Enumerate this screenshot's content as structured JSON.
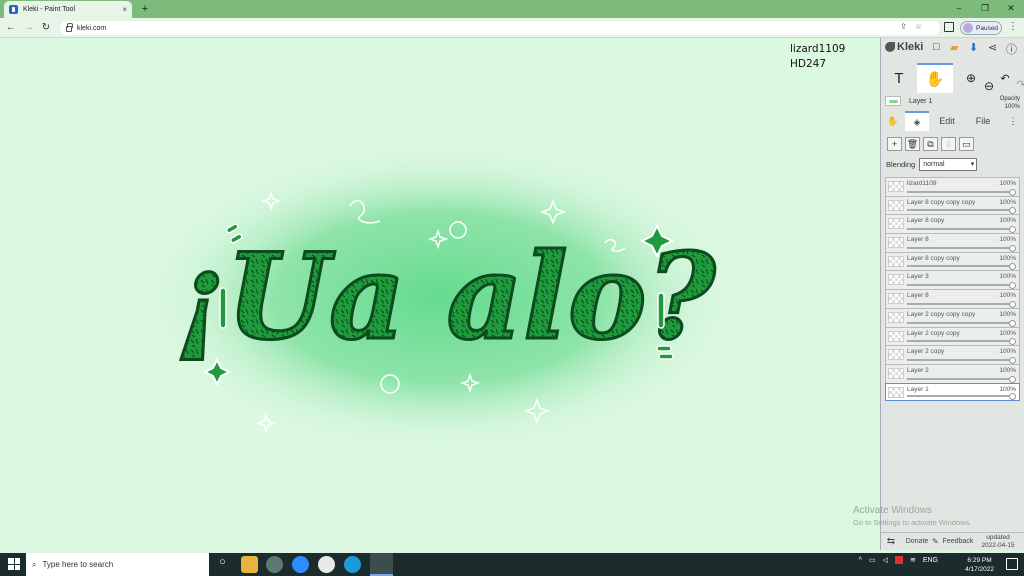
{
  "browser": {
    "tab_title": "Kleki - Paint Tool",
    "new_tab": "+",
    "close_tab": "×",
    "url": "kleki.com",
    "profile_status": "Paused",
    "window_controls": {
      "minimize": "–",
      "restore": "❐",
      "close": "✕"
    }
  },
  "canvas": {
    "author_note_line1": "lizard1109",
    "author_note_line2": "HD247",
    "artwork_text": "¡Ua alo?"
  },
  "app": {
    "logo": "Kleki",
    "active_tool_icon": "hand-icon",
    "current_layer": "Layer 1",
    "opacity_label": "Opacity",
    "opacity_value": "100%",
    "tabs": {
      "edit": "Edit",
      "file": "File"
    },
    "blending_label": "Blending",
    "blending_value": "normal",
    "layers": [
      {
        "name": "lizard1109",
        "opacity": "100%"
      },
      {
        "name": "Layer 8 copy copy copy",
        "opacity": "100%"
      },
      {
        "name": "Layer 8 copy",
        "opacity": "100%"
      },
      {
        "name": "Layer 8",
        "opacity": "100%"
      },
      {
        "name": "Layer 8 copy copy",
        "opacity": "100%"
      },
      {
        "name": "Layer 3",
        "opacity": "100%"
      },
      {
        "name": "Layer 8",
        "opacity": "100%"
      },
      {
        "name": "Layer 2 copy copy copy",
        "opacity": "100%"
      },
      {
        "name": "Layer 2 copy copy",
        "opacity": "100%"
      },
      {
        "name": "Layer 2 copy",
        "opacity": "100%"
      },
      {
        "name": "Layer 2",
        "opacity": "100%"
      },
      {
        "name": "Layer 1",
        "opacity": "100%",
        "selected": true
      }
    ],
    "bottom": {
      "donate": "Donate",
      "feedback": "Feedback",
      "updated_label": "updated",
      "updated_date": "2022-04-15"
    }
  },
  "os": {
    "activate_title": "Activate Windows",
    "activate_sub": "Go to Settings to activate Windows.",
    "search_placeholder": "Type here to search",
    "language": "ENG",
    "time": "6:29 PM",
    "date": "4/17/2022"
  },
  "colors": {
    "accent_green": "#3fa55a",
    "canvas_bg": "#dbf8e1",
    "browser_chrome": "#7dbb7b"
  }
}
